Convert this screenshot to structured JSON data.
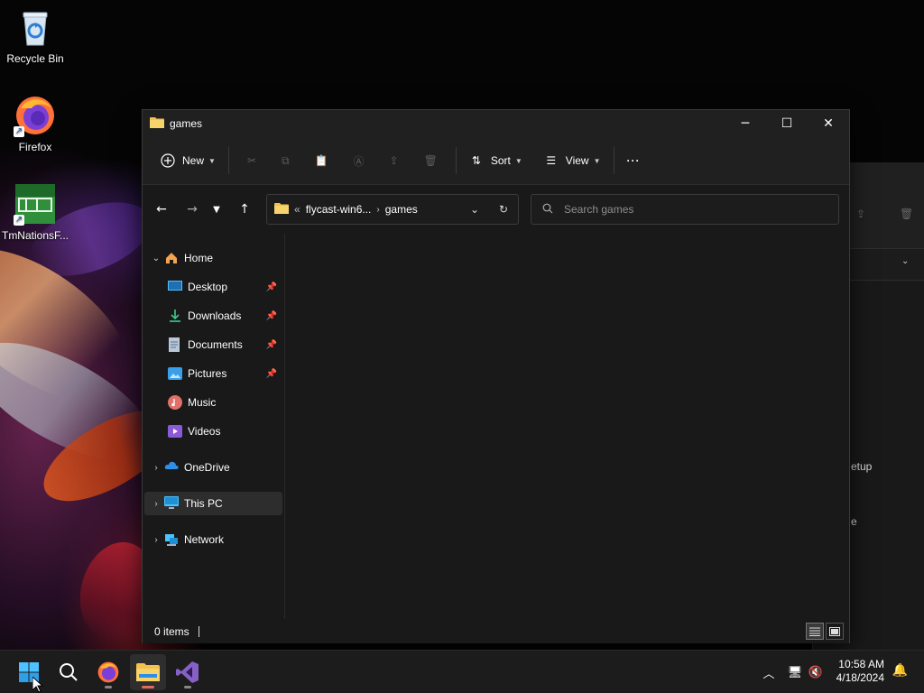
{
  "desktop": {
    "icons": [
      {
        "label": "Recycle Bin",
        "icon": "recycle-bin-icon"
      },
      {
        "label": "Firefox",
        "icon": "firefox-icon"
      },
      {
        "label": "TmNationsF...",
        "icon": "tmnations-icon"
      }
    ]
  },
  "background_window": {
    "fragments": [
      "etup",
      "e"
    ]
  },
  "window": {
    "title": "games",
    "controls": {
      "minimize": "minimize-icon",
      "maximize": "maximize-icon",
      "close": "close-icon"
    },
    "toolbar": {
      "new_label": "New",
      "sort_label": "Sort",
      "view_label": "View",
      "more_label": "···"
    },
    "address": {
      "overflow": "«",
      "segments": [
        "flycast-win6...",
        "games"
      ]
    },
    "search": {
      "placeholder": "Search games"
    },
    "nav": {
      "home": "Home",
      "quick_access": [
        {
          "label": "Desktop",
          "pinned": true,
          "icon": "desktop-icon"
        },
        {
          "label": "Downloads",
          "pinned": true,
          "icon": "downloads-icon"
        },
        {
          "label": "Documents",
          "pinned": true,
          "icon": "documents-icon"
        },
        {
          "label": "Pictures",
          "pinned": true,
          "icon": "pictures-icon"
        },
        {
          "label": "Music",
          "pinned": false,
          "icon": "music-icon"
        },
        {
          "label": "Videos",
          "pinned": false,
          "icon": "videos-icon"
        }
      ],
      "onedrive": "OneDrive",
      "this_pc": "This PC",
      "network": "Network"
    },
    "status": {
      "item_count": "0 items"
    }
  },
  "taskbar": {
    "apps": [
      "start-icon",
      "search-icon",
      "firefox-icon",
      "file-explorer-icon",
      "visual-studio-icon"
    ],
    "clock": {
      "time": "10:58 AM",
      "date": "4/18/2024"
    }
  },
  "colors": {
    "window_bg": "#191919",
    "toolbar_bg": "#202020",
    "accent_folder": "#f2c14e",
    "accent_blue": "#4cc2ff"
  }
}
